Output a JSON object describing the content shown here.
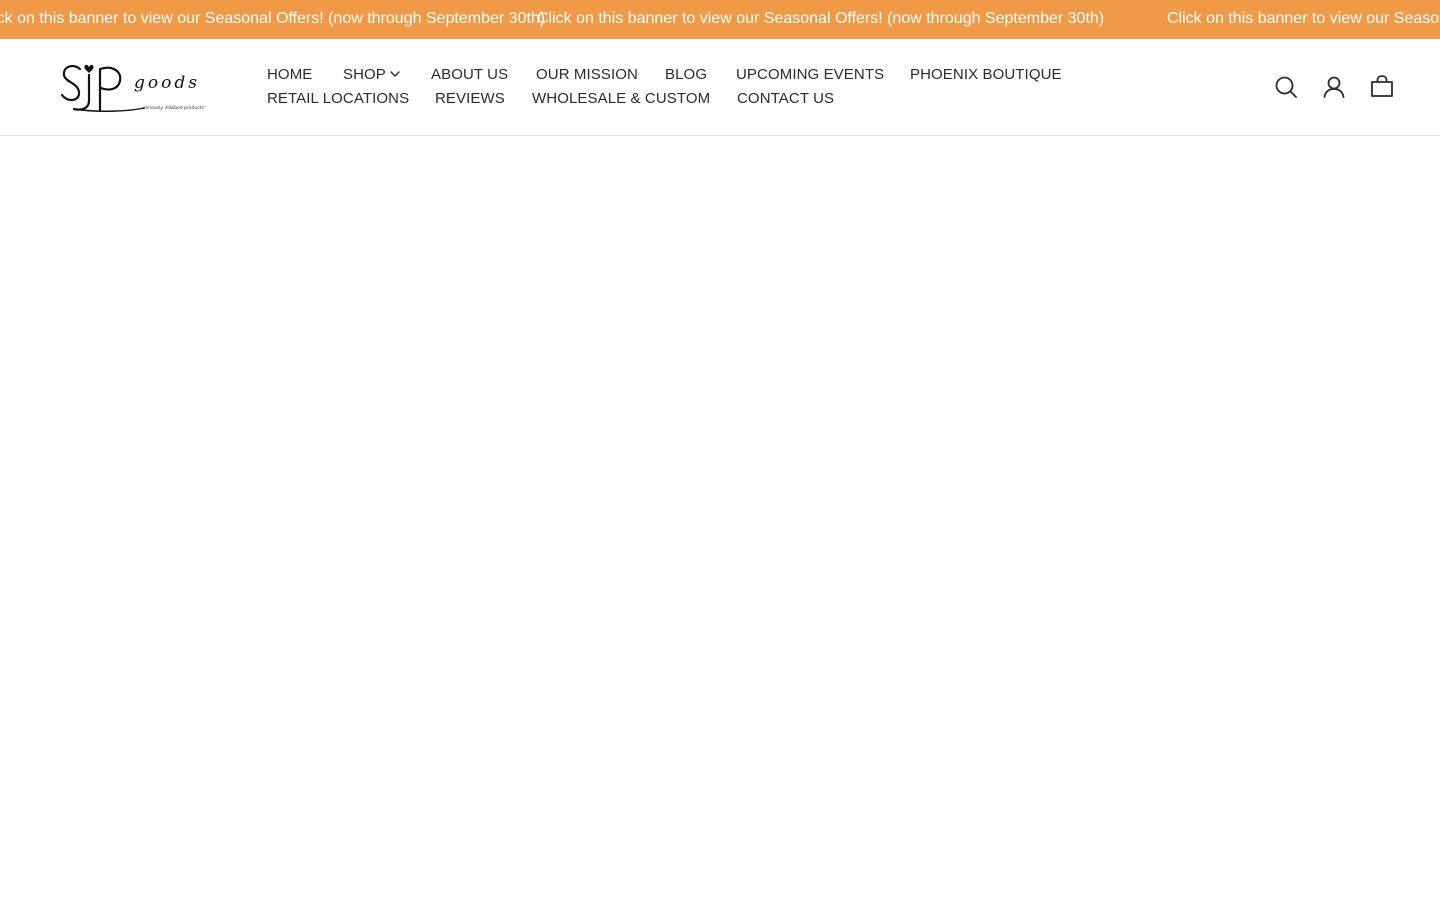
{
  "announcement": {
    "text": "Click on this banner to view our Seasonal Offers! (now through September 30th)",
    "background": "#f09a48"
  },
  "logo": {
    "name": "SIP goods",
    "tagline": "seriously imbibed products"
  },
  "nav": {
    "row1": {
      "home": "HOME",
      "shop": "SHOP",
      "about": "ABOUT US",
      "mission": "OUR MISSION",
      "blog": "BLOG",
      "events": "UPCOMING EVENTS",
      "boutique": "PHOENIX BOUTIQUE"
    },
    "row2": {
      "retail": "RETAIL LOCATIONS",
      "reviews": "REVIEWS",
      "wholesale": "WHOLESALE & CUSTOM",
      "contact": "CONTACT US"
    }
  },
  "icons": {
    "search": "search-icon",
    "account": "account-icon",
    "cart": "cart-icon"
  }
}
